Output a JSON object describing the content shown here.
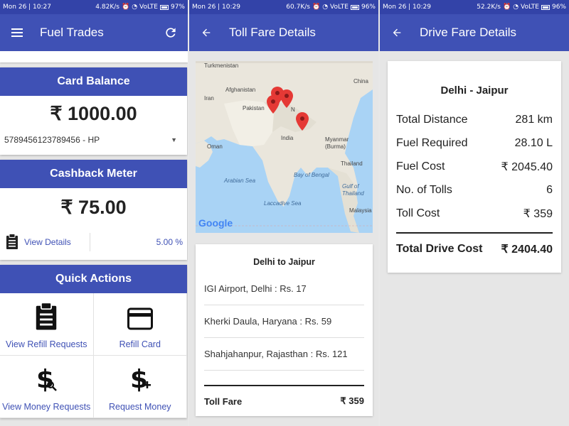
{
  "screen1": {
    "status": {
      "time": "Mon 26 | 10:27",
      "speed": "4.82K/s",
      "network": "VoLTE",
      "battery": "97%"
    },
    "appbar": {
      "title": "Fuel Trades"
    },
    "card_balance": {
      "header": "Card Balance",
      "amount": "₹ 1000.00",
      "selected_card": "5789456123789456 - HP"
    },
    "cashback": {
      "header": "Cashback Meter",
      "amount": "₹ 75.00",
      "view_details": "View Details",
      "percent": "5.00 %"
    },
    "quick_actions": {
      "header": "Quick Actions",
      "items": [
        "View Refill Requests",
        "Refill Card",
        "View Money Requests",
        "Request Money"
      ]
    }
  },
  "screen2": {
    "status": {
      "time": "Mon 26 | 10:29",
      "speed": "60.7K/s",
      "network": "VoLTE",
      "battery": "96%"
    },
    "appbar": {
      "title": "Toll Fare Details"
    },
    "map": {
      "labels": [
        "Turkmenistan",
        "Afghanistan",
        "Pakistan",
        "Iran",
        "Oman",
        "India",
        "China",
        "Myanmar (Burma)",
        "Thailand",
        "Malaysia",
        "N"
      ],
      "seas": [
        "Arabian Sea",
        "Bay of Bengal",
        "Laccadive Sea",
        "Gulf of Thailand"
      ],
      "google": "Google"
    },
    "route": {
      "title": "Delhi to Jaipur",
      "tolls": [
        "IGI Airport, Delhi : Rs. 17",
        "Kherki Daula, Haryana : Rs. 59",
        "Shahjahanpur, Rajasthan : Rs. 121"
      ],
      "total_label": "Toll Fare",
      "total_value": "₹ 359"
    }
  },
  "screen3": {
    "status": {
      "time": "Mon 26 | 10:29",
      "speed": "52.2K/s",
      "network": "VoLTE",
      "battery": "96%"
    },
    "appbar": {
      "title": "Drive Fare Details"
    },
    "drive": {
      "title": "Delhi - Jaipur",
      "rows": [
        {
          "label": "Total Distance",
          "value": "281 km"
        },
        {
          "label": "Fuel Required",
          "value": "28.10 L"
        },
        {
          "label": "Fuel Cost",
          "value": "₹ 2045.40"
        },
        {
          "label": "No. of Tolls",
          "value": "6"
        },
        {
          "label": "Toll Cost",
          "value": "₹ 359"
        }
      ],
      "total_label": "Total Drive Cost",
      "total_value": "₹ 2404.40"
    }
  },
  "colors": {
    "primary": "#3f51b5",
    "status_bar": "#3343a8",
    "background": "#e6e6e6",
    "marker": "#e53935"
  }
}
